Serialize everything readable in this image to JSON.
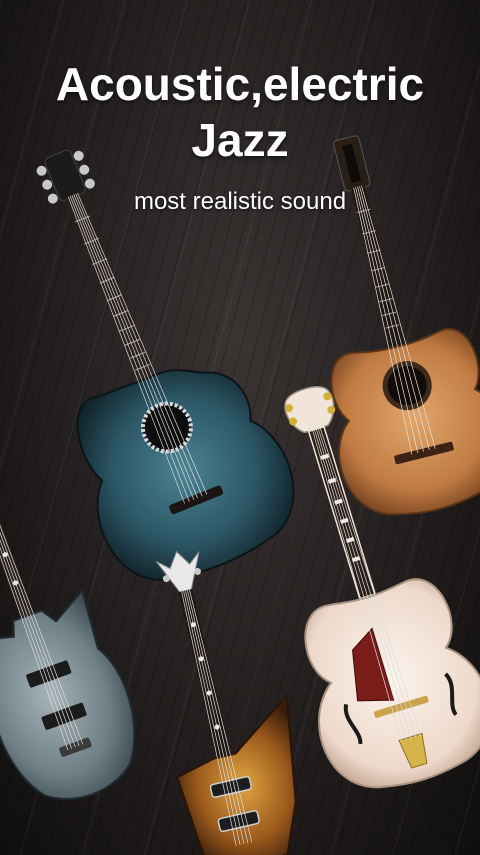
{
  "headline": {
    "line1": "Acoustic,electric",
    "line2": "Jazz"
  },
  "subheadline": "most realistic sound",
  "colors": {
    "background": "#231f1e",
    "text": "#ffffff",
    "teal_body": "#2f5f6e",
    "natural_wood": "#c9874f",
    "cream_body": "#f3e6dc",
    "sunburst": "#c98a2c",
    "metal_gray": "#7d8d96"
  },
  "guitars": [
    {
      "icon": "teal-acoustic-guitar-icon"
    },
    {
      "icon": "classical-guitar-icon"
    },
    {
      "icon": "jazz-archtop-guitar-icon"
    },
    {
      "icon": "rusted-electric-guitar-icon"
    },
    {
      "icon": "explorer-electric-guitar-icon"
    }
  ]
}
